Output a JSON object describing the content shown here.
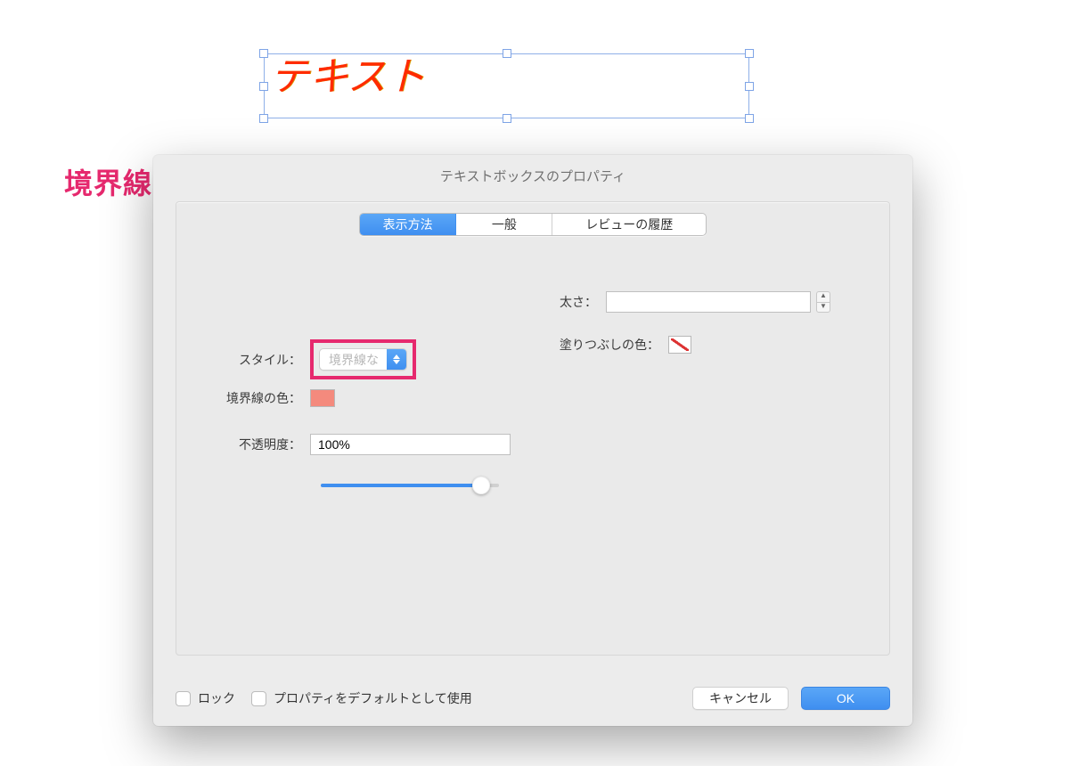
{
  "textbox": {
    "content": "テキスト"
  },
  "annotation": {
    "label": "境界線なし"
  },
  "dialog": {
    "title": "テキストボックスのプロパティ",
    "tabs": [
      {
        "label": "表示方法",
        "active": true
      },
      {
        "label": "一般",
        "active": false
      },
      {
        "label": "レビューの履歴",
        "active": false
      }
    ],
    "style": {
      "label": "スタイル：",
      "selected": "境界線な"
    },
    "border_color": {
      "label": "境界線の色：",
      "value": "#f48a7d"
    },
    "opacity": {
      "label": "不透明度：",
      "value": "100%",
      "slider_percent": 100
    },
    "thickness": {
      "label": "太さ：",
      "value": ""
    },
    "fill_color": {
      "label": "塗りつぶしの色：",
      "value": "none"
    },
    "footer": {
      "lock_label": "ロック",
      "default_label": "プロパティをデフォルトとして使用",
      "cancel": "キャンセル",
      "ok": "OK"
    }
  }
}
